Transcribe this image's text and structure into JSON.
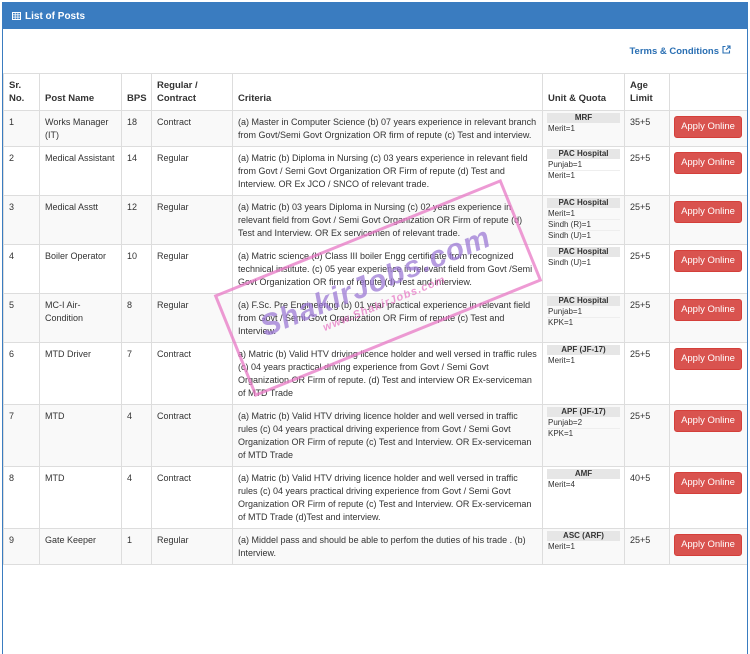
{
  "panel": {
    "title": "List of Posts"
  },
  "terms": {
    "label": "Terms & Conditions"
  },
  "columns": {
    "sr": "Sr. No.",
    "name": "Post Name",
    "bps": "BPS",
    "regular": "Regular / Contract",
    "criteria": "Criteria",
    "unit": "Unit & Quota",
    "age": "Age Limit"
  },
  "apply_label": "Apply Online",
  "rows": [
    {
      "sr": "1",
      "name": "Works Manager (IT)",
      "bps": "18",
      "regular": "Contract",
      "criteria": "(a)  Master in Computer Science (b) 07 years experience in relevant branch from Govt/Semi Govt Orgnization OR firm of repute (c) Test and interview.",
      "unit_title": "MRF",
      "quota": [
        "Merit=1"
      ],
      "age": "35+5"
    },
    {
      "sr": "2",
      "name": "Medical Assistant",
      "bps": "14",
      "regular": "Regular",
      "criteria": "(a) Matric (b) Diploma in Nursing (c) 03 years experience in relevant field from Govt / Semi Govt Organization OR Firm of repute (d) Test and Interview. OR Ex JCO / SNCO of relevant trade.",
      "unit_title": "PAC Hospital",
      "quota": [
        "Punjab=1",
        "Merit=1"
      ],
      "age": "25+5"
    },
    {
      "sr": "3",
      "name": "Medical Asstt",
      "bps": "12",
      "regular": "Regular",
      "criteria": "(a) Matric (b) 03 years Diploma in Nursing (c) 02 years experience in relevant field from Govt / Semi Govt Organization OR Firm of repute (d) Test and Interview. OR Ex servicemen of relevant trade.",
      "unit_title": "PAC Hospital",
      "quota": [
        "Merit=1",
        "Sindh (R)=1",
        "Sindh (U)=1"
      ],
      "age": "25+5"
    },
    {
      "sr": "4",
      "name": "Boiler Operator",
      "bps": "10",
      "regular": "Regular",
      "criteria": "(a) Matric science (b) Class III boiler Engg certificate from recognized technical institute. (c) 05 year experience in relevant field from Govt /Semi Govt Organization OR firm of repute (d) Test and interview.",
      "unit_title": "PAC Hospital",
      "quota": [
        "Sindh (U)=1"
      ],
      "age": "25+5"
    },
    {
      "sr": "5",
      "name": "MC-I Air-Condition",
      "bps": "8",
      "regular": "Regular",
      "criteria": "(a) F.Sc. Pre Engineering (b) 01 year practical experience in relevant field from Govt / Semi Govt Organization OR Firm of repute (c) Test and Interview.",
      "unit_title": "PAC Hospital",
      "quota": [
        "Punjab=1",
        "KPK=1"
      ],
      "age": "25+5"
    },
    {
      "sr": "6",
      "name": "MTD Driver",
      "bps": "7",
      "regular": "Contract",
      "criteria": "a) Matric (b) Valid HTV driving licence holder and well versed in traffic rules (c) 04 years practical driving experience from Govt / Semi Govt Organization OR Firm of repute. (d) Test and interview OR  Ex-serviceman of MTD Trade",
      "unit_title": "APF (JF-17)",
      "quota": [
        "Merit=1"
      ],
      "age": "25+5"
    },
    {
      "sr": "7",
      "name": "MTD",
      "bps": "4",
      "regular": "Contract",
      "criteria": "(a) Matric (b) Valid HTV driving licence holder and well versed in traffic rules (c) 04 years practical driving experience from Govt / Semi Govt Organization OR Firm of repute (c) Test and Interview. OR Ex-serviceman of MTD Trade",
      "unit_title": "APF (JF-17)",
      "quota": [
        "Punjab=2",
        "KPK=1"
      ],
      "age": "25+5"
    },
    {
      "sr": "8",
      "name": "MTD",
      "bps": "4",
      "regular": "Contract",
      "criteria": "(a) Matric (b) Valid HTV driving licence holder and well versed in traffic rules (c) 04 years practical driving experience from Govt / Semi Govt Organization OR Firm of repute (c) Test and Interview. OR Ex-serviceman of MTD Trade (d)Test and interview.",
      "unit_title": "AMF",
      "quota": [
        "Merit=4"
      ],
      "age": "40+5"
    },
    {
      "sr": "9",
      "name": "Gate Keeper",
      "bps": "1",
      "regular": "Regular",
      "criteria": "(a) Middel pass and should be able to perfom the duties of his trade . (b) Interview.",
      "unit_title": "ASC (ARF)",
      "quota": [
        "Merit=1"
      ],
      "age": "25+5"
    }
  ],
  "watermark": {
    "main": "ShakirJobs.com",
    "sub": "www.ShakirJobs.com"
  },
  "colors": {
    "header_bg": "#3a7cc0",
    "button_bg": "#d9534f",
    "link": "#2a6fb3",
    "stamp": "#e879c6"
  }
}
